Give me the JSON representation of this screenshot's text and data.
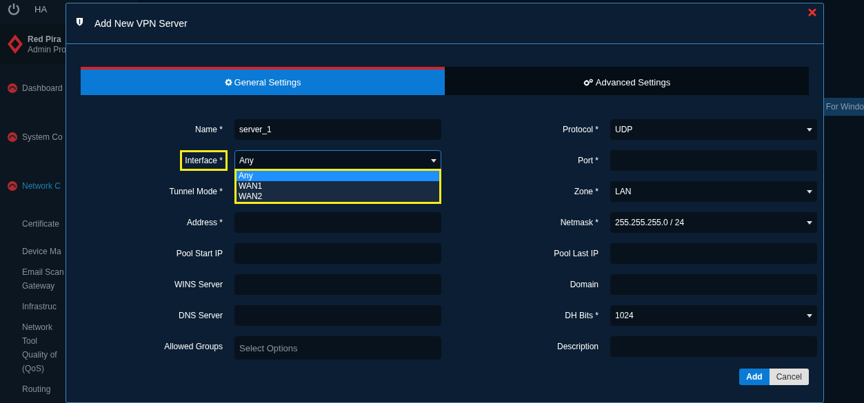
{
  "sidebar": {
    "top_label": "HA",
    "brand": {
      "name": "Red Pira",
      "subtitle": "Admin Pro"
    },
    "items": [
      {
        "label": "Dashboard",
        "kind": "main",
        "selected": false
      },
      {
        "label": "System Co",
        "kind": "main",
        "selected": false
      },
      {
        "label": "Network C",
        "kind": "main",
        "selected": true
      },
      {
        "label": "Certificate",
        "kind": "sub",
        "selected": false
      },
      {
        "label": "Device Ma",
        "kind": "sub",
        "selected": false
      },
      {
        "label": "Email Scan Gateway",
        "kind": "sub",
        "selected": false
      },
      {
        "label": "Infrastruc",
        "kind": "sub",
        "selected": false
      },
      {
        "label": "Network Tool",
        "kind": "sub",
        "selected": false
      },
      {
        "label": "Quality of (QoS)",
        "kind": "sub",
        "selected": false
      },
      {
        "label": "Routing",
        "kind": "sub",
        "selected": false
      }
    ]
  },
  "background_button": {
    "label": "For Windo"
  },
  "modal": {
    "title": "Add New VPN Server",
    "tabs": [
      {
        "label": "General Settings",
        "selected": true
      },
      {
        "label": "Advanced Settings",
        "selected": false
      }
    ],
    "left_fields": [
      {
        "label": "Name *",
        "kind": "text",
        "value": "server_1"
      },
      {
        "label": "Interface *",
        "kind": "select",
        "value": "Any",
        "highlighted": true,
        "expanded": true,
        "options": [
          {
            "label": "Any",
            "selected": true
          },
          {
            "label": "WAN1",
            "selected": false
          },
          {
            "label": "WAN2",
            "selected": false
          }
        ]
      },
      {
        "label": "Tunnel Mode *",
        "kind": "text"
      },
      {
        "label": "Address *",
        "kind": "text"
      },
      {
        "label": "Pool Start IP",
        "kind": "text"
      },
      {
        "label": "WINS Server",
        "kind": "text"
      },
      {
        "label": "DNS Server",
        "kind": "text"
      },
      {
        "label": "Allowed Groups",
        "kind": "multi",
        "placeholder": "Select Options"
      }
    ],
    "right_fields": [
      {
        "label": "Protocol *",
        "kind": "select",
        "value": "UDP"
      },
      {
        "label": "Port *",
        "kind": "text"
      },
      {
        "label": "Zone *",
        "kind": "select",
        "value": "LAN"
      },
      {
        "label": "Netmask *",
        "kind": "select",
        "value": "255.255.255.0 / 24"
      },
      {
        "label": "Pool Last IP",
        "kind": "text"
      },
      {
        "label": "Domain",
        "kind": "text"
      },
      {
        "label": "DH Bits *",
        "kind": "select",
        "value": "1024"
      },
      {
        "label": "Description",
        "kind": "text"
      }
    ],
    "buttons": [
      {
        "label": "Add",
        "kind": "primary"
      },
      {
        "label": "Cancel",
        "kind": "secondary"
      }
    ]
  }
}
